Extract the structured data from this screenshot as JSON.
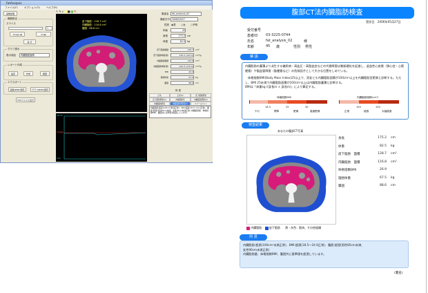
{
  "app": {
    "title": "FatAnalysis",
    "menu": [
      "ファイル(F)",
      "オプション(O)",
      "ヘルプ(H)"
    ],
    "tab": "画像処理",
    "range_group": "範囲設定",
    "slice_label": "スライス",
    "slice_value": "1",
    "buttons_nav": [
      "Image ◀",
      "Go ▶"
    ],
    "exec_button": "実 行",
    "graph_group": "グラフ表示",
    "graph_item_label": "表示項目",
    "graph_item_value": "内臓脂肪面積",
    "report_group": "レポート作成",
    "report_buttons": [
      "設定",
      "作成",
      "履歴"
    ],
    "export_group": "エクスポート",
    "export_buttons": [
      "画像(BMP)保存",
      "グラフ(BMP)保存"
    ],
    "csv_button": "CSVファイル出力",
    "overlay": {
      "sub": "皮下脂肪 : 128.7 cm²",
      "vis": "内臓脂肪 : 116.8 cm²",
      "waist": "腹囲 : 88.6 cm"
    },
    "graph_ticks": [
      "200.00",
      "116.80",
      "0.00"
    ],
    "form": {
      "name_label": "患者名",
      "name": "fat_analysis_02",
      "date_label": "撮影日付",
      "date": "2006/05/27",
      "sex_label": "性別",
      "sex_options": [
        "男",
        "女",
        "不明"
      ],
      "age_label": "年齢",
      "age": "45",
      "height_label": "身長",
      "height": "175.2",
      "height_unit": "cm",
      "weight_label": "体重",
      "weight": "82.5",
      "weight_unit": "kg",
      "rows": [
        {
          "label": "皮下脂肪面積",
          "value": "128.7",
          "unit": "cm²"
        },
        {
          "label": "皮下脂肪体積(量)",
          "value": "130.2 (125.9)",
          "unit": "cm³/g"
        },
        {
          "label": "内臓脂肪面積",
          "value": "116.8",
          "unit": "cm²"
        },
        {
          "label": "内臓脂肪体積(量)",
          "value": "120.3 (115.9)",
          "unit": "cm³/g"
        },
        {
          "label": "BMI",
          "value": "26.9",
          "unit": ""
        },
        {
          "label": "理想体重",
          "value": "67.5",
          "unit": "kg"
        },
        {
          "label": "腹囲",
          "value": "88.6",
          "unit": "cm"
        }
      ],
      "findings_label": "所 見",
      "tabs": [
        "正常",
        "正常(V)",
        "皮下脂肪肥満",
        "皮下脂肪肥満(V)",
        "内臓脂肪型",
        "内臓脂肪肥満(V)",
        "内臓脂肪肥満",
        "内臓脂肪型肥満(V)",
        "フリーコメント"
      ],
      "text": "内臓脂肪:超過(100cm²未満正常)、BMI:超過(18.5〜24.9正常)、腹囲:超過(男性85cm未満、女性90cm未満正常) 内臓脂肪量、体格指数BMI、腹囲共に基準値を超過しています。"
    }
  },
  "report": {
    "title": "腹部CT法内臓脂肪検査",
    "date_label": "受診日",
    "date": "2006年05月27日",
    "reception_label": "受付番号",
    "id_label": "患者ID",
    "id": "03-3225-0744",
    "name_label": "氏名",
    "name": "fat_analysis_02",
    "honorific": "様",
    "age_label": "年齢",
    "age": "45",
    "age_unit": "歳",
    "sex_label": "性別",
    "sex": "男性",
    "explain_label": "解 説",
    "explain": [
      "内臓脂肪の蓄積より派生する糖尿病・高血圧・高脂血症などの代謝障害は動脈硬化を促進し、虚血性心疾患（狭心症・心筋梗塞）や脳血管障害（脳梗塞など）の危険因子として大きな位置をしめている。",
      "体格指数BMI(Body Mass Index)25以上で、男女とも内臓脂肪面積が100cm²以上を内臓脂肪型肥満と診断する。ただし、BMI 25未満で内臓脂肪面積が100cm²以上は内臓脂肪蓄積と診断する。",
      "BMIは「体重kg /(身長m × 身長m)」により算定する。"
    ],
    "bmi_scale": {
      "title": "体格指数BMI",
      "ticks": [
        "18.5",
        "25",
        "30"
      ],
      "labels": [
        "やせ",
        "標準",
        "肥満",
        "高度肥満"
      ]
    },
    "fat_scale": {
      "title": "内臓脂肪面積(cm²)",
      "ticks": [
        "100",
        "150"
      ],
      "labels": [
        "正常",
        "超過",
        "大幅超過"
      ]
    },
    "result_label": "検査結果",
    "ct_caption": "あなたの腹部CT写真",
    "values": [
      {
        "label": "身長",
        "value": "175.2",
        "unit": "cm"
      },
      {
        "label": "体重",
        "value": "82.5",
        "unit": "kg"
      },
      {
        "label": "皮下脂肪　面積",
        "value": "128.7",
        "unit": "cm²"
      },
      {
        "label": "内臓脂肪　面積",
        "value": "116.8",
        "unit": "cm²"
      },
      {
        "label": "体格指数BMI",
        "value": "26.9",
        "unit": ""
      },
      {
        "label": "理想体重",
        "value": "67.5",
        "unit": "kg"
      },
      {
        "label": "腹囲",
        "value": "88.6",
        "unit": "cm"
      }
    ],
    "legend": {
      "visceral": "内臓脂肪",
      "subcutaneous": "皮下脂肪",
      "other": "黒・灰色：筋肉、その他組織"
    },
    "findings_label": "所 見",
    "findings": [
      "内臓脂肪:超過(100cm²未満正常)、BMI:超過(18.5〜24.9正常)、腹囲:超過(男性85cm未満、",
      "女性90cm未満正常)",
      "内臓脂肪量、体格指数BMI、腹囲共に基準値を超過しています。"
    ],
    "signature": "(署名)"
  },
  "colors": {
    "accent": "#0a84ff",
    "visceral": "#d81b7a",
    "subcutaneous": "#1f4fd0"
  }
}
